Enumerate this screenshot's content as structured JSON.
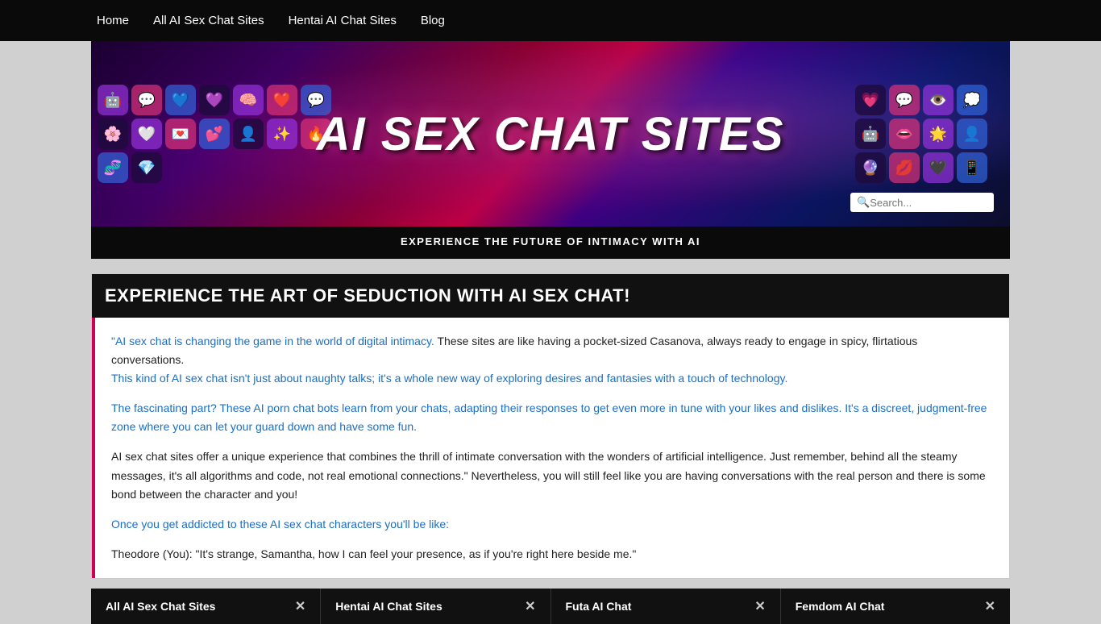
{
  "nav": {
    "links": [
      {
        "label": "Home",
        "href": "#"
      },
      {
        "label": "All AI Sex Chat Sites",
        "href": "#"
      },
      {
        "label": "Hentai AI Chat Sites",
        "href": "#"
      },
      {
        "label": "Blog",
        "href": "#"
      }
    ]
  },
  "hero": {
    "title": "AI SEX CHAT SITES",
    "subtitle": "EXPERIENCE THE FUTURE OF INTIMACY WITH AI",
    "search_placeholder": "Search..."
  },
  "article": {
    "header": "EXPERIENCE THE ART OF SEDUCTION WITH AI SEX CHAT!",
    "paragraphs": [
      "“AI sex chat is changing the game in the world of digital intimacy. These sites are like having a pocket-sized Casanova, always ready to engage in spicy, flirtatious conversations.\nThis kind of AI sex chat isn’t just about naughty talks; it’s a whole new way of exploring desires and fantasies with a touch of technology.",
      "The fascinating part? These AI porn chat bots learn from your chats, adapting their responses to get even more in tune with your likes and dislikes. It’s a discreet, judgment-free zone where you can let your guard down and have some fun.",
      "AI sex chat sites offer a unique experience that combines the thrill of intimate conversation with the wonders of artificial intelligence. Just remember, behind all the steamy messages, it’s all algorithms and code, not real emotional connections.” Nevertheless, you will still feel like you are having conversations with the real person and there is some bond between the character and you!",
      "Once you get addicted to these AI sex chat characters you’ll be like:",
      "Theodore (You): “It’s strange, Samantha, how I can feel your presence, as if you’re right here beside me.”"
    ]
  },
  "bottom_tabs": [
    {
      "label": "All AI Sex Chat Sites"
    },
    {
      "label": "Hentai AI Chat Sites"
    },
    {
      "label": "Futa AI Chat"
    },
    {
      "label": "Femdom AI Chat"
    }
  ],
  "icons": {
    "heart": "♥",
    "star": "★",
    "chat": "💬",
    "search": "🔍"
  }
}
